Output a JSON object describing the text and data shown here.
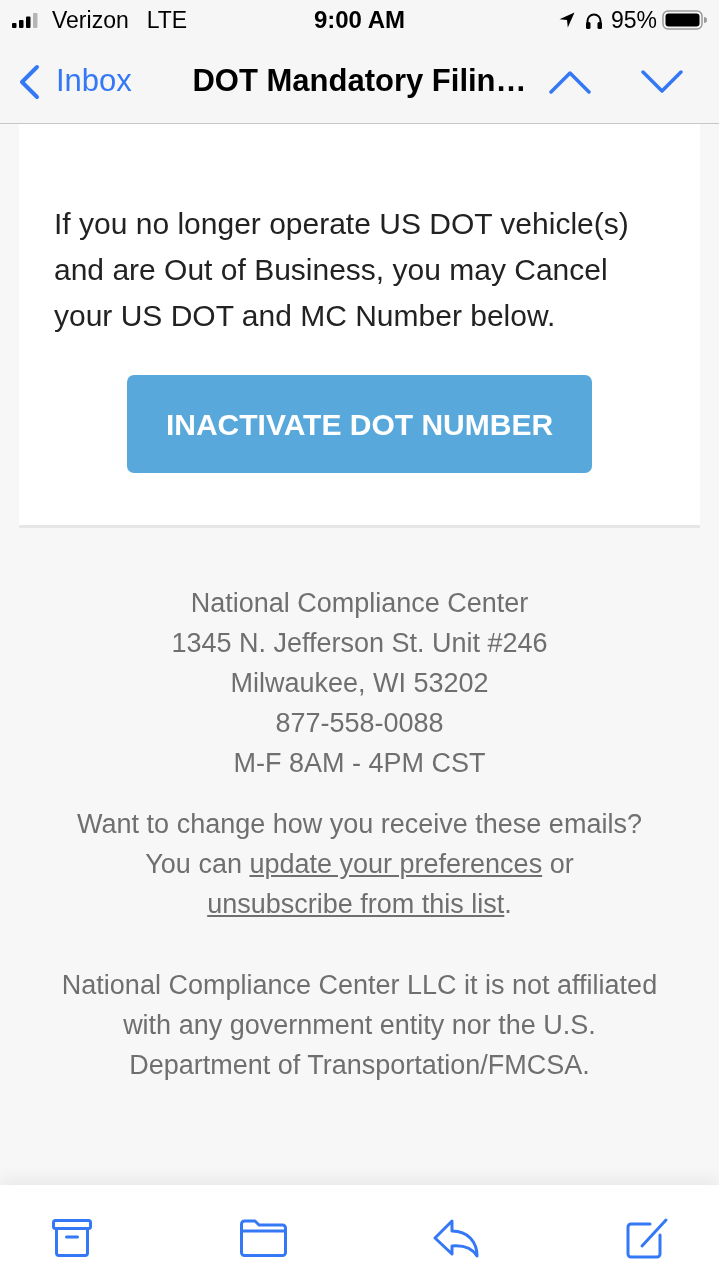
{
  "status_bar": {
    "carrier": "Verizon",
    "network": "LTE",
    "time": "9:00 AM",
    "battery": "95%"
  },
  "nav_bar": {
    "back_label": "Inbox",
    "title": "DOT Mandatory Filin…"
  },
  "email": {
    "body": "If you no longer operate US DOT vehicle(s) and are Out of Business, you may Cancel your US DOT and MC Number below.",
    "button": "INACTIVATE DOT NUMBER"
  },
  "footer": {
    "address_lines": [
      "National Compliance Center",
      "1345 N. Jefferson St. Unit #246",
      "Milwaukee, WI 53202",
      "877-558-0088",
      "M-F 8AM - 4PM CST"
    ],
    "preferences": {
      "lead": "Want to change how you receive these emails? You can",
      "preferences_link": "update your preferences",
      "joiner": "or",
      "unsubscribe_link": "unsubscribe from this list",
      "end": "."
    },
    "disclaimer": "National Compliance Center LLC it is not affiliated with any government entity nor the U.S. Department of Transportation/FMCSA."
  }
}
